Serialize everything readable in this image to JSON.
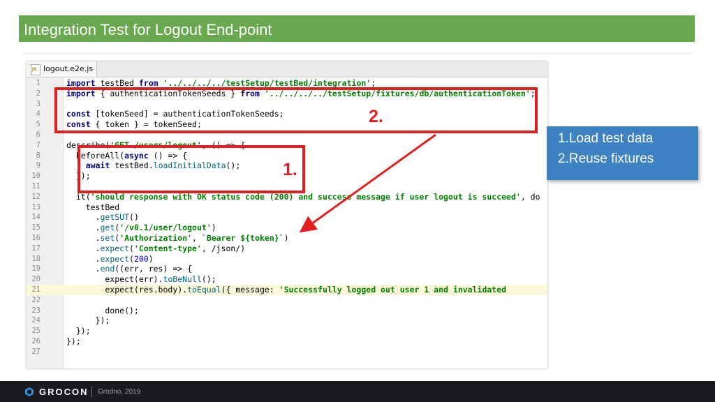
{
  "slide": {
    "title": "Integration Test for Logout End-point"
  },
  "editor": {
    "tab_filename": "logout.e2e.js",
    "file_icon_text": "JS"
  },
  "code_lines": [
    {
      "n": "1",
      "t": "import testBed from '../../../../testSetup/testBed/integration';"
    },
    {
      "n": "2",
      "t": "import { authenticationTokenSeeds } from '../../../../testSetup/fixtures/db/authenticationToken';"
    },
    {
      "n": "3",
      "t": ""
    },
    {
      "n": "4",
      "t": "const [tokenSeed] = authenticationTokenSeeds;"
    },
    {
      "n": "5",
      "t": "const { token } = tokenSeed;"
    },
    {
      "n": "6",
      "t": ""
    },
    {
      "n": "7",
      "t": "describe('GET /users/logout', () => {"
    },
    {
      "n": "8",
      "t": "  beforeAll(async () => {"
    },
    {
      "n": "9",
      "t": "    await testBed.loadInitialData();"
    },
    {
      "n": "10",
      "t": "  });"
    },
    {
      "n": "11",
      "t": ""
    },
    {
      "n": "12",
      "t": "  it('should response with OK status code (200) and success message if user logout is succeed', do"
    },
    {
      "n": "13",
      "t": "    testBed"
    },
    {
      "n": "14",
      "t": "      .getSUT()"
    },
    {
      "n": "15",
      "t": "      .get('/v0.1/user/logout')"
    },
    {
      "n": "16",
      "t": "      .set('Authorization', `Bearer ${token}`)"
    },
    {
      "n": "17",
      "t": "      .expect('Content-type', /json/)"
    },
    {
      "n": "18",
      "t": "      .expect(200)"
    },
    {
      "n": "19",
      "t": "      .end((err, res) => {"
    },
    {
      "n": "20",
      "t": "        expect(err).toBeNull();"
    },
    {
      "n": "21",
      "t": "        expect(res.body).toEqual({ message: 'Successfully logged out user 1 and invalidated"
    },
    {
      "n": "22",
      "t": ""
    },
    {
      "n": "23",
      "t": "        done();"
    },
    {
      "n": "24",
      "t": "      });"
    },
    {
      "n": "25",
      "t": "  });"
    },
    {
      "n": "26",
      "t": "});"
    },
    {
      "n": "27",
      "t": ""
    }
  ],
  "annotations": {
    "marker_2": "2.",
    "marker_1": "1."
  },
  "callout": {
    "line1": "1.Load test data",
    "line2": "2.Reuse fixtures"
  },
  "footer": {
    "logo": "GROCON",
    "subtitle": "Grodno, 2019"
  },
  "colors": {
    "title_bar": "#6aa84f",
    "callout_bg": "#3d82c3",
    "annotation_red": "#e02020",
    "footer_bg": "#1b1b1f"
  }
}
